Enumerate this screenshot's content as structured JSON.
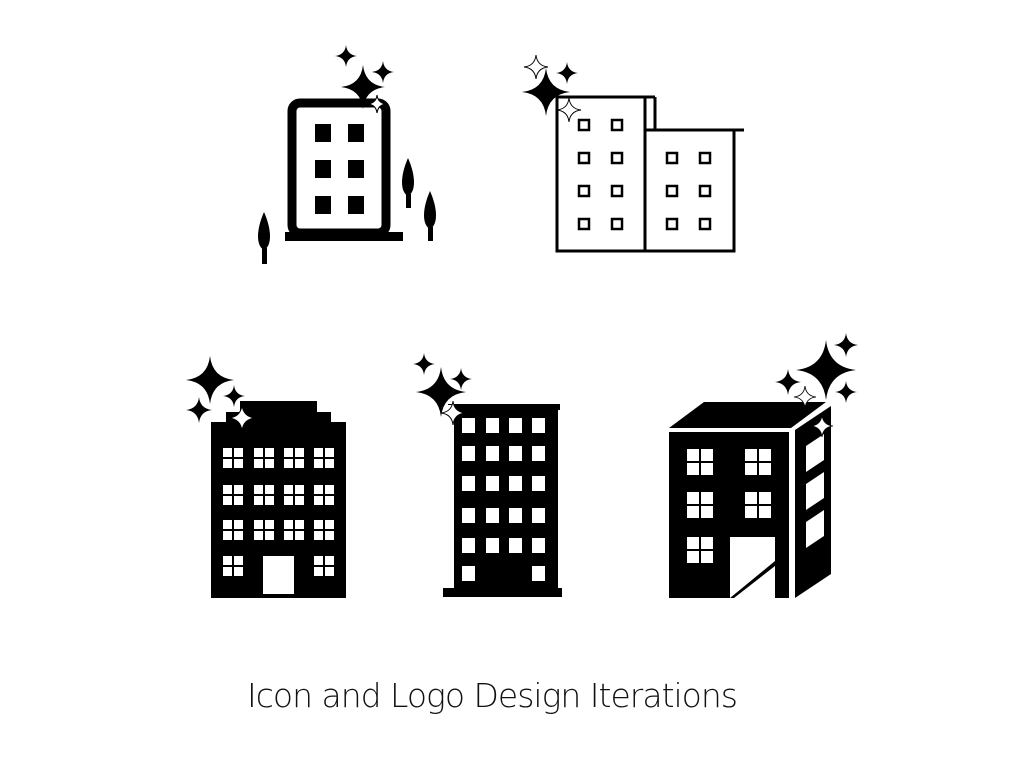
{
  "caption": "Icon and Logo Design Iterations",
  "icons": [
    {
      "name": "building-with-trees",
      "style": "outline-solid-windows"
    },
    {
      "name": "two-block-outline",
      "style": "outline"
    },
    {
      "name": "stepped-roof-tower",
      "style": "solid"
    },
    {
      "name": "tall-grid-tower",
      "style": "solid"
    },
    {
      "name": "isometric-building",
      "style": "solid"
    }
  ],
  "colors": {
    "ink": "#000000",
    "background": "#ffffff",
    "caption": "#111111"
  }
}
